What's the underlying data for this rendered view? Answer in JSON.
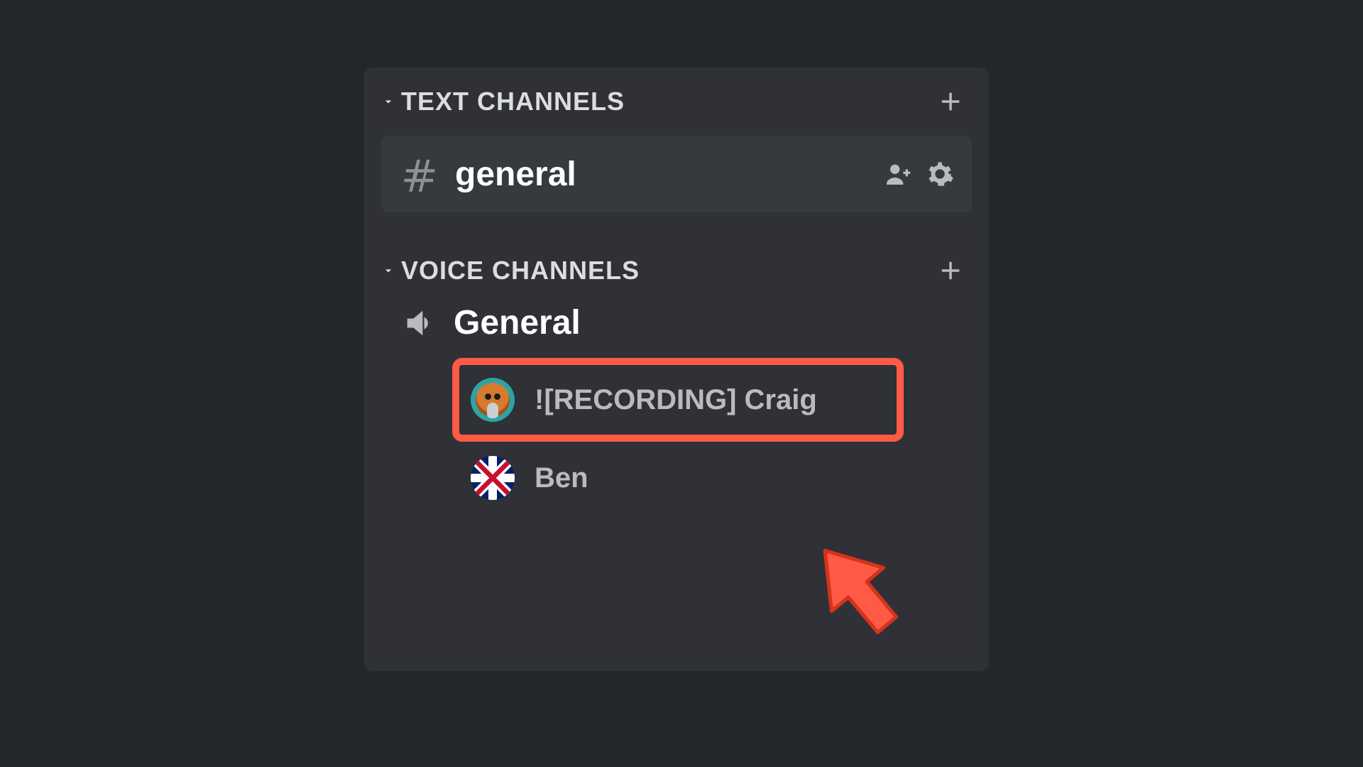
{
  "categories": {
    "text": {
      "label": "TEXT CHANNELS"
    },
    "voice": {
      "label": "VOICE CHANNELS"
    }
  },
  "text_channels": [
    {
      "name": "general"
    }
  ],
  "voice_channels": [
    {
      "name": "General",
      "participants": [
        {
          "name": "![RECORDING] Craig",
          "avatar": "craig",
          "highlighted": true
        },
        {
          "name": "Ben",
          "avatar": "ben",
          "highlighted": false
        }
      ]
    }
  ],
  "annotation": {
    "highlight_color": "#ff5a44",
    "cursor_arrow": true
  }
}
